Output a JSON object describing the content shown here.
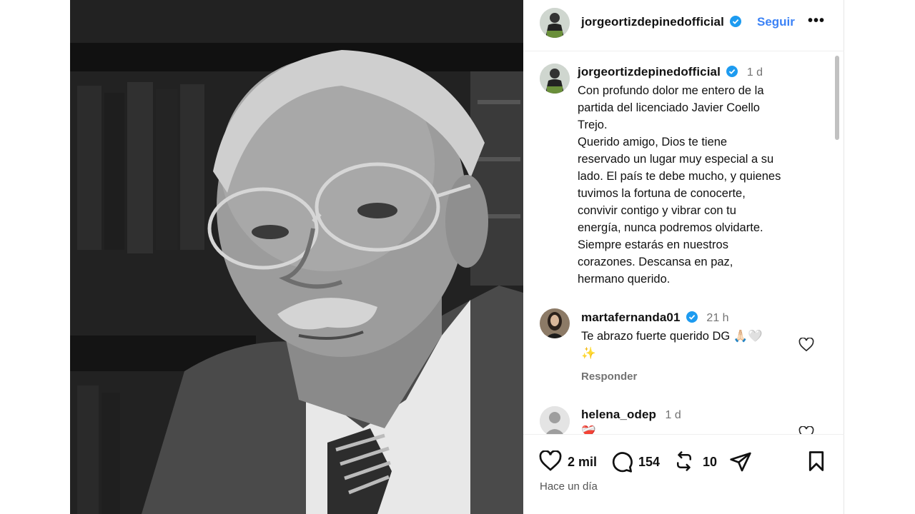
{
  "post": {
    "username": "jorgeortizdepinedofficial",
    "follow_label": "Seguir",
    "more_label": "•••"
  },
  "caption": {
    "username": "jorgeortizdepinedofficial",
    "time": "1 d",
    "text": "Con profundo dolor me entero de la\npartida del licenciado Javier Coello\nTrejo.\nQuerido amigo, Dios te tiene\nreservado un lugar muy especial a su\nlado. El país te debe mucho, y quienes\ntuvimos la fortuna de conocerte,\nconvivir contigo y vibrar con tu\nenergía, nunca podremos olvidarte.\nSiempre estarás en nuestros\ncorazones. Descansa en paz,\nhermano querido."
  },
  "comments": [
    {
      "username": "martafernanda01",
      "time": "21 h",
      "text_line1": "Te abrazo fuerte querido DG 🙏🏻🤍",
      "text_line2": "✨",
      "reply_label": "Responder"
    },
    {
      "username": "helena_odep",
      "time": "1 d",
      "text_line1": "❤️‍🩹"
    }
  ],
  "actions": {
    "likes": "2 mil",
    "comments": "154",
    "reposts": "10"
  },
  "date": "Hace un día",
  "colors": {
    "accent": "#3b82f6",
    "verified": "#1d9bf0",
    "muted": "#737373"
  }
}
